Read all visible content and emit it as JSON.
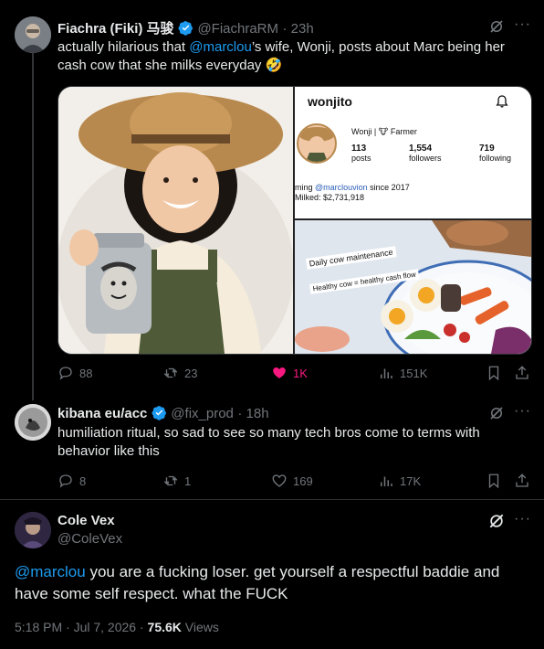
{
  "tweet1": {
    "name": "Fiachra (Fiki) 马骏",
    "handle": "@FiachraRM",
    "time": "· 23h",
    "text_before": "actually hilarious that ",
    "mention": "@marclou",
    "text_after": "’s wife, Wonji, posts about Marc being her cash cow that she milks everyday 🤣",
    "replies": "88",
    "retweets": "23",
    "likes": "1K",
    "views": "151K",
    "profile": {
      "username": "wonjito",
      "bio": "Wonji | 🐮 Farmer",
      "posts": "113",
      "posts_label": "posts",
      "followers": "1,554",
      "followers_label": "followers",
      "following": "719",
      "following_label": "following",
      "line1_pre": "ming ",
      "line1_mention": "@marclouvion",
      "line1_post": " since 2017",
      "line2": "Milked: $2,731,918"
    },
    "food_caption1": "Daily cow maintenance",
    "food_caption2": "Healthy cow = healthy cash flow"
  },
  "tweet2": {
    "name": "kibana eu/acc",
    "handle": "@fix_prod",
    "time": "· 18h",
    "text": "humiliation ritual, so sad to see so many tech bros come to terms with behavior like this",
    "replies": "8",
    "retweets": "1",
    "likes": "169",
    "views": "17K"
  },
  "tweet3": {
    "name": "Cole Vex",
    "handle": "@ColeVex",
    "mention": "@marclou",
    "text": " you are a fucking loser. get yourself a respectful baddie and have some self respect. what the FUCK",
    "timestamp": "5:18 PM · Jul 7, 2026 · ",
    "views_count": "75.6K",
    "views_label": " Views"
  },
  "colors": {
    "accent": "#1d9bf0",
    "like": "#f91880",
    "muted": "#71767b"
  }
}
